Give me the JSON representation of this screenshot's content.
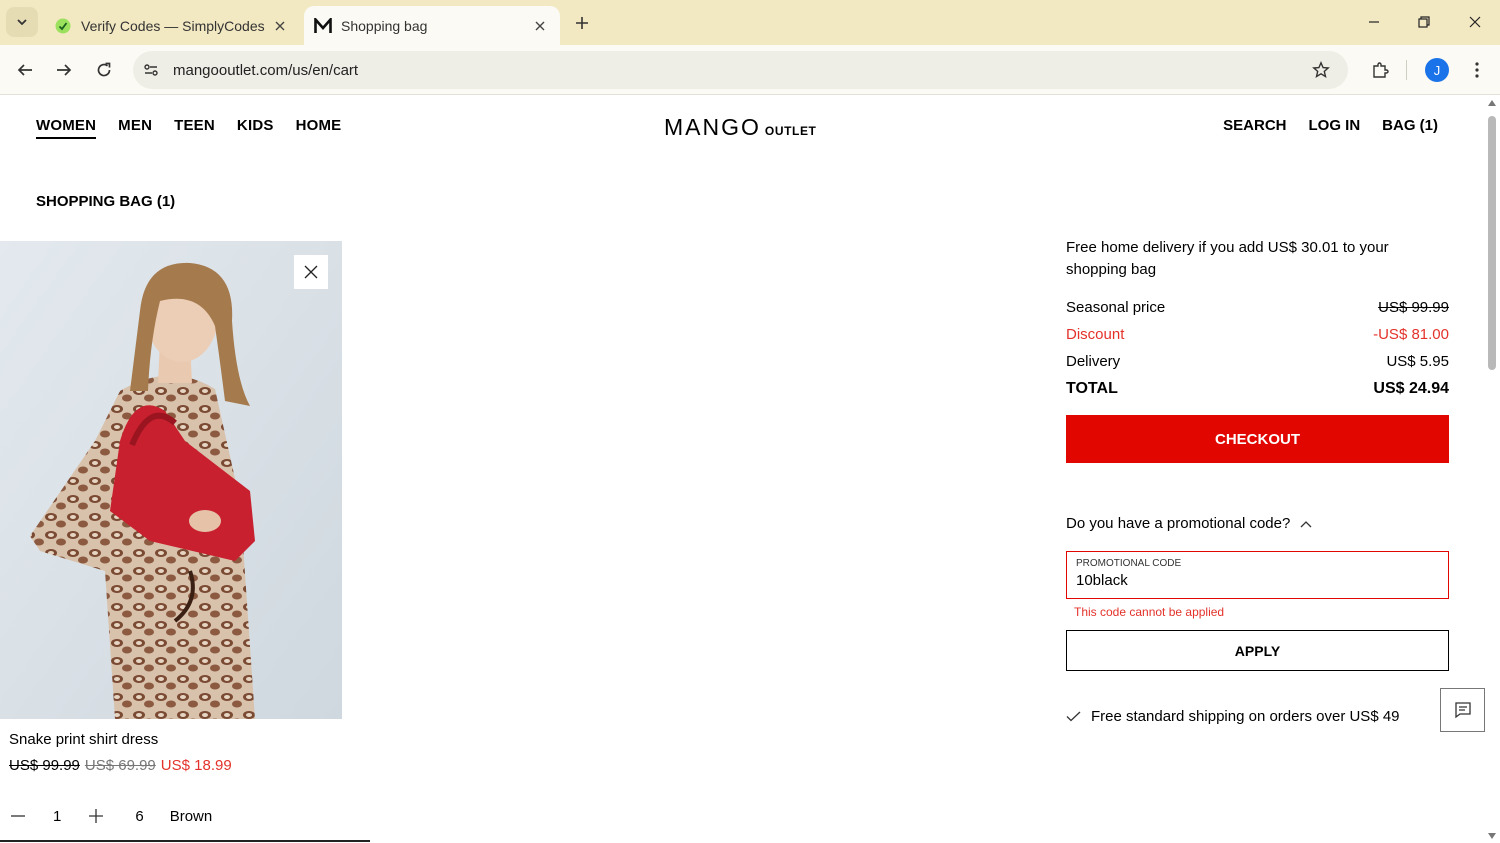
{
  "browser": {
    "tabs": [
      {
        "title": "Verify Codes — SimplyCodes",
        "active": false
      },
      {
        "title": "Shopping bag",
        "active": true
      }
    ],
    "url": "mangooutlet.com/us/en/cart",
    "avatar_letter": "J",
    "colors": {
      "tabstrip": "#f2e8c2",
      "toolbar": "#fbfaf4",
      "avatar": "#1a73e8"
    }
  },
  "header": {
    "nav": [
      "WOMEN",
      "MEN",
      "TEEN",
      "KIDS",
      "HOME"
    ],
    "logo_main": "MANGO",
    "logo_sub": "OUTLET",
    "search": "SEARCH",
    "login": "LOG IN",
    "bag": "BAG (1)"
  },
  "bag": {
    "title": "SHOPPING BAG (1)",
    "item": {
      "name": "Snake print shirt dress",
      "price_original": "US$ 99.99",
      "price_previous": "US$ 69.99",
      "price_current": "US$ 18.99",
      "quantity": "1",
      "size": "6",
      "color": "Brown"
    }
  },
  "summary": {
    "free_delivery_msg": "Free home delivery if you add US$ 30.01 to your shopping bag",
    "seasonal_label": "Seasonal price",
    "seasonal_value": "US$ 99.99",
    "discount_label": "Discount",
    "discount_value": "-US$ 81.00",
    "delivery_label": "Delivery",
    "delivery_value": "US$ 5.95",
    "total_label": "TOTAL",
    "total_value": "US$ 24.94",
    "checkout_label": "CHECKOUT"
  },
  "promo": {
    "question": "Do you have a promotional code?",
    "field_label": "PROMOTIONAL CODE",
    "field_value": "10black",
    "error": "This code cannot be applied",
    "apply_label": "APPLY"
  },
  "shipping_note": "Free standard shipping on orders over US$ 49",
  "accent_colors": {
    "checkout": "#e10600",
    "sale": "#e4322b"
  }
}
